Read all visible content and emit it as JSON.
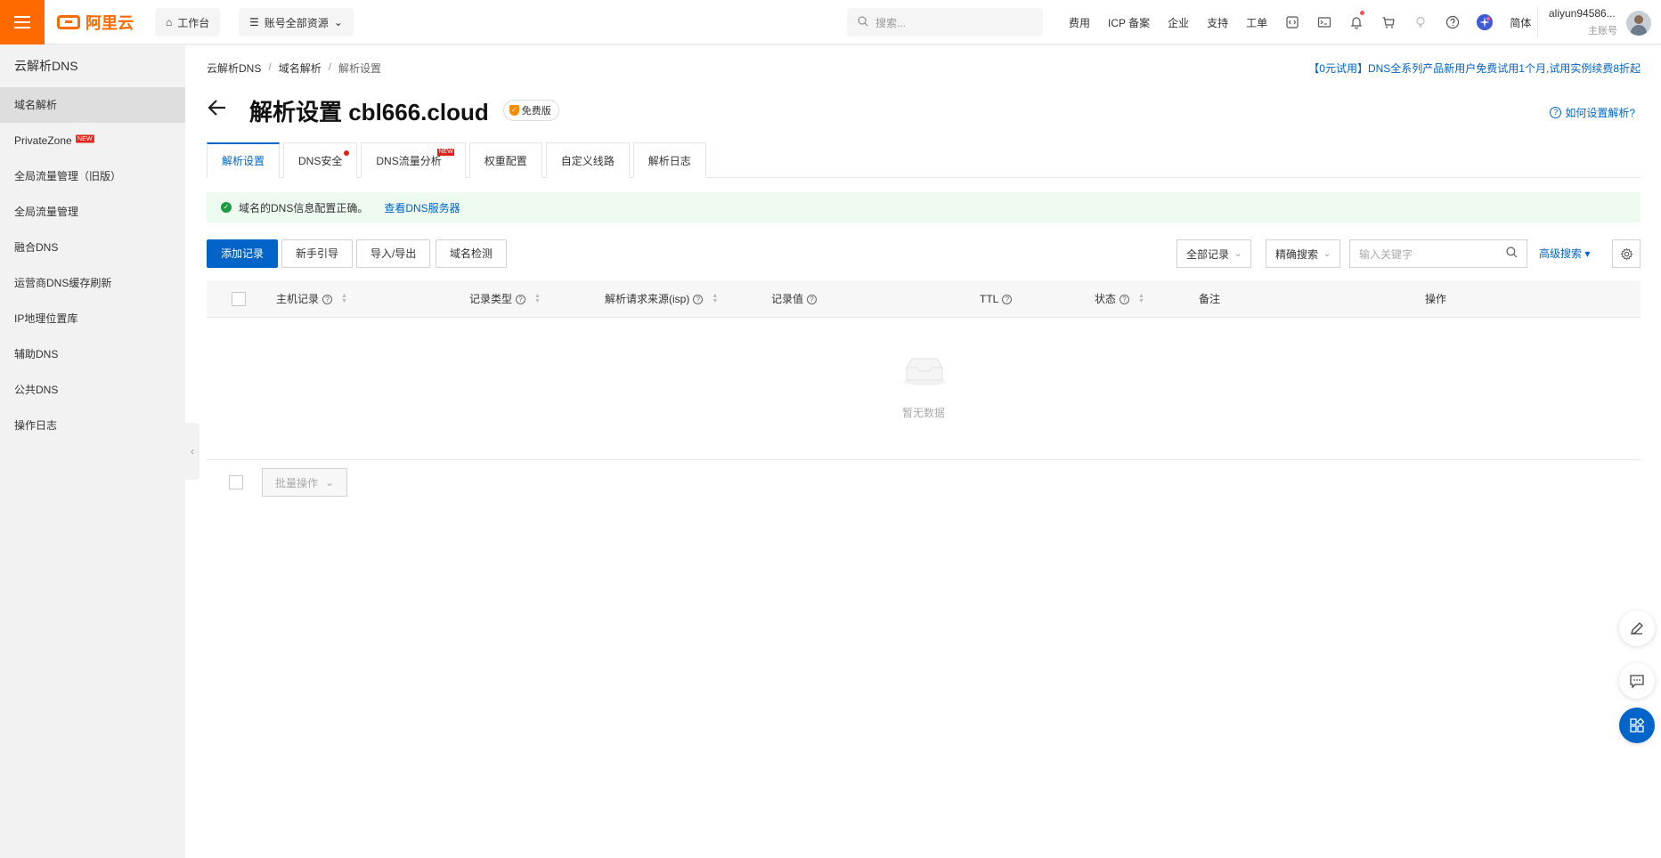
{
  "topbar": {
    "brand": "阿里云",
    "workbench": "工作台",
    "resources": "账号全部资源",
    "search_placeholder": "搜索...",
    "links": [
      "费用",
      "ICP 备案",
      "企业",
      "支持",
      "工单"
    ],
    "language": "简体",
    "user_name": "aliyun94586...",
    "user_role": "主账号"
  },
  "sidebar": {
    "title": "云解析DNS",
    "items": [
      {
        "label": "域名解析",
        "active": true
      },
      {
        "label": "PrivateZone",
        "badge": "NEW"
      },
      {
        "label": "全局流量管理（旧版）"
      },
      {
        "label": "全局流量管理"
      },
      {
        "label": "融合DNS"
      },
      {
        "label": "运营商DNS缓存刷新"
      },
      {
        "label": "IP地理位置库"
      },
      {
        "label": "辅助DNS"
      },
      {
        "label": "公共DNS"
      },
      {
        "label": "操作日志"
      }
    ]
  },
  "breadcrumb": [
    "云解析DNS",
    "域名解析",
    "解析设置"
  ],
  "promo": "【0元试用】DNS全系列产品新用户免费试用1个月,试用实例续费8折起",
  "page": {
    "title": "解析设置 cbl666.cloud",
    "edition": "免费版",
    "help": "如何设置解析?"
  },
  "tabs": [
    {
      "label": "解析设置"
    },
    {
      "label": "DNS安全"
    },
    {
      "label": "DNS流量分析",
      "badge": "NEW"
    },
    {
      "label": "权重配置"
    },
    {
      "label": "自定义线路"
    },
    {
      "label": "解析日志"
    }
  ],
  "alert": {
    "text": "域名的DNS信息配置正确。",
    "link": "查看DNS服务器"
  },
  "toolbar": {
    "add": "添加记录",
    "guide": "新手引导",
    "import_export": "导入/导出",
    "check": "域名检测",
    "filter": "全部记录",
    "search_mode": "精确搜索",
    "keyword_placeholder": "输入关键字",
    "advanced": "高级搜索"
  },
  "table": {
    "columns": [
      "主机记录",
      "记录类型",
      "解析请求来源(isp)",
      "记录值",
      "TTL",
      "状态",
      "备注",
      "操作"
    ],
    "empty": "暂无数据",
    "batch": "批量操作"
  },
  "colors": {
    "accent": "#ff6a00",
    "primary": "#0064c8",
    "success_bg": "#ecfaf0",
    "success": "#1a9e3f"
  }
}
